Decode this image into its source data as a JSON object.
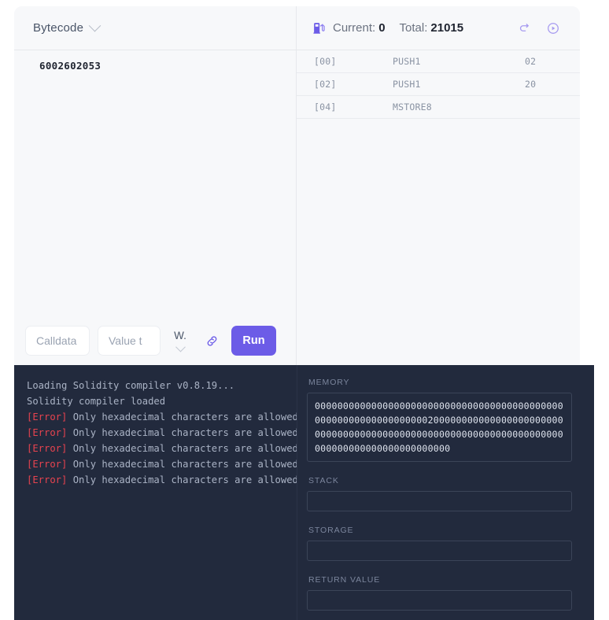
{
  "editor": {
    "mode_label": "Bytecode",
    "chevron_icon": "chevron-down-icon",
    "code": "6002602053"
  },
  "toolbar": {
    "calldata_placeholder": "Calldata",
    "calldata_value": "",
    "value_placeholder": "Value t",
    "value_value": "",
    "unit_label": "W.",
    "unit_chevron_icon": "chevron-down-icon",
    "link_icon": "link-icon",
    "run_label": "Run"
  },
  "gas": {
    "icon": "gas-pump-icon",
    "current_label": "Current:",
    "current_value": "0",
    "total_label": "Total:",
    "total_value": "21015",
    "reset_icon": "reset-arrow-icon",
    "step_icon": "play-circle-icon"
  },
  "opcodes": {
    "rows": [
      {
        "pc": "[00]",
        "name": "PUSH1",
        "arg": "02"
      },
      {
        "pc": "[02]",
        "name": "PUSH1",
        "arg": "20"
      },
      {
        "pc": "[04]",
        "name": "MSTORE8",
        "arg": ""
      }
    ]
  },
  "console": {
    "lines": [
      {
        "tag": "",
        "text": "Loading Solidity compiler v0.8.19..."
      },
      {
        "tag": "",
        "text": "Solidity compiler loaded"
      },
      {
        "tag": "[Error]",
        "text": " Only hexadecimal characters are allowed"
      },
      {
        "tag": "[Error]",
        "text": " Only hexadecimal characters are allowed"
      },
      {
        "tag": "[Error]",
        "text": " Only hexadecimal characters are allowed"
      },
      {
        "tag": "[Error]",
        "text": " Only hexadecimal characters are allowed"
      },
      {
        "tag": "[Error]",
        "text": " Only hexadecimal characters are allowed"
      }
    ]
  },
  "state": {
    "memory_label": "MEMORY",
    "memory_value": "000000000000000000000000000000000000000000000000000000000000000020000000000000000000000000000000000000000000000000000000000000000000000000000000000000000000",
    "stack_label": "STACK",
    "stack_value": "",
    "storage_label": "STORAGE",
    "storage_value": "",
    "return_label": "RETURN VALUE",
    "return_value": ""
  },
  "colors": {
    "accent": "#6c5ce7",
    "panel_dark": "#222a3d",
    "error": "#e8434f",
    "card_bg": "#f7f8fa"
  }
}
